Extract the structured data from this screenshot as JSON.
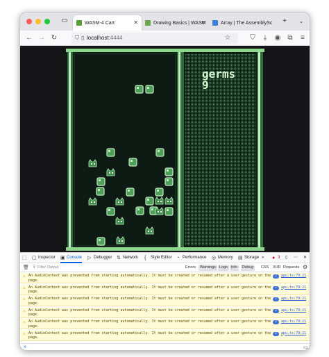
{
  "browser": {
    "tabs": [
      {
        "label": "WASM-4 Cart",
        "favicon_color": "#5a9d3a",
        "active": true
      },
      {
        "label": "Drawing Basics | WASM",
        "favicon_color": "#6aa84f",
        "active": false
      },
      {
        "label": "Array | The AssemblySc",
        "favicon_color": "#3b7dd8",
        "active": false
      }
    ],
    "url_host": "localhost",
    "url_port": ":4444"
  },
  "game": {
    "title": "germs",
    "count": "9"
  },
  "devtools": {
    "tabs": [
      {
        "label": "Inspector",
        "icon": "inspector-icon"
      },
      {
        "label": "Console",
        "icon": "console-icon",
        "active": true
      },
      {
        "label": "Debugger",
        "icon": "debugger-icon"
      },
      {
        "label": "Network",
        "icon": "network-icon"
      },
      {
        "label": "Style Editor",
        "icon": "style-editor-icon"
      },
      {
        "label": "Performance",
        "icon": "performance-icon"
      },
      {
        "label": "Memory",
        "icon": "memory-icon"
      },
      {
        "label": "Storage",
        "icon": "storage-icon"
      }
    ],
    "error_count": "3",
    "filter_placeholder": "Filter Output",
    "filters": [
      "Errors",
      "Warnings",
      "Logs",
      "Info",
      "Debug"
    ],
    "filter_extra": [
      "CSS",
      "XHR",
      "Requests"
    ],
    "messages": [
      {
        "text": "An AudioContext was prevented from starting automatically. It must be created or resumed after a user gesture on the page.",
        "count": "2",
        "source": "apu.ts:79:21"
      },
      {
        "text": "An AudioContext was prevented from starting automatically. It must be created or resumed after a user gesture on the page.",
        "count": "2",
        "source": "apu.ts:79:21"
      },
      {
        "text": "An AudioContext was prevented from starting automatically. It must be created or resumed after a user gesture on the page.",
        "count": "2",
        "source": "apu.ts:79:21"
      },
      {
        "text": "An AudioContext was prevented from starting automatically. It must be created or resumed after a user gesture on the page.",
        "count": "2",
        "source": "apu.ts:79:21"
      },
      {
        "text": "An AudioContext was prevented from starting automatically. It must be created or resumed after a user gesture on the page.",
        "count": "2",
        "source": "apu.ts:79:21"
      },
      {
        "text": "An AudioContext was prevented from starting automatically. It must be created or resumed after a user gesture on the page.",
        "count": "2",
        "source": "apu.ts:79:21"
      }
    ],
    "prompt": "»"
  },
  "colors": {
    "game_bg": "#0e1a14",
    "game_light": "#c4f0c2",
    "game_mid": "#5ab568",
    "game_dark": "#1e3a28"
  }
}
